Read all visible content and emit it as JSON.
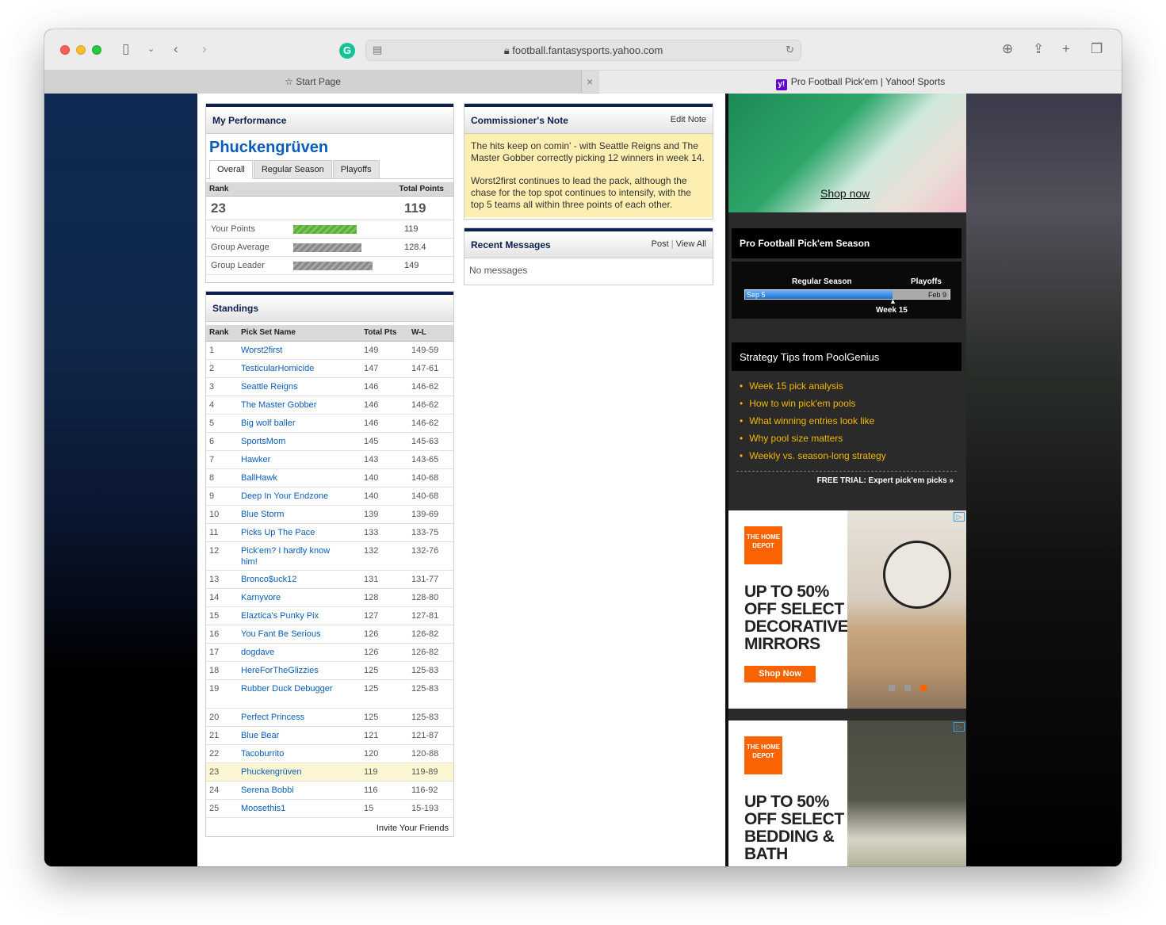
{
  "browser": {
    "url": "football.fantasysports.yahoo.com",
    "tabs": [
      {
        "label": "Start Page"
      },
      {
        "label": "Pro Football Pick'em | Yahoo! Sports"
      }
    ]
  },
  "performance": {
    "title": "My Performance",
    "team_name": "Phuckengrüven",
    "tabs": [
      "Overall",
      "Regular Season",
      "Playoffs"
    ],
    "rank_label": "Rank",
    "total_points_label": "Total Points",
    "rank": "23",
    "total_points": "119",
    "rows": [
      {
        "label": "Your Points",
        "value": "119",
        "fraction": 0.8,
        "style": "green"
      },
      {
        "label": "Group Average",
        "value": "128.4",
        "fraction": 0.86,
        "style": "gray"
      },
      {
        "label": "Group Leader",
        "value": "149",
        "fraction": 1.0,
        "style": "gray"
      }
    ]
  },
  "standings": {
    "title": "Standings",
    "columns": [
      "Rank",
      "Pick Set Name",
      "Total Pts",
      "W-L"
    ],
    "rows": [
      {
        "rank": "1",
        "name": "Worst2first",
        "pts": "149",
        "wl": "149-59"
      },
      {
        "rank": "2",
        "name": "TesticularHomicide",
        "pts": "147",
        "wl": "147-61"
      },
      {
        "rank": "3",
        "name": "Seattle Reigns",
        "pts": "146",
        "wl": "146-62"
      },
      {
        "rank": "4",
        "name": "The Master Gobber",
        "pts": "146",
        "wl": "146-62"
      },
      {
        "rank": "5",
        "name": "Big wolf baller",
        "pts": "146",
        "wl": "146-62"
      },
      {
        "rank": "6",
        "name": "SportsMom",
        "pts": "145",
        "wl": "145-63"
      },
      {
        "rank": "7",
        "name": "Hawker",
        "pts": "143",
        "wl": "143-65"
      },
      {
        "rank": "8",
        "name": "BallHawk",
        "pts": "140",
        "wl": "140-68"
      },
      {
        "rank": "9",
        "name": "Deep In Your Endzone",
        "pts": "140",
        "wl": "140-68"
      },
      {
        "rank": "10",
        "name": "Blue Storm",
        "pts": "139",
        "wl": "139-69"
      },
      {
        "rank": "11",
        "name": "Picks Up The Pace",
        "pts": "133",
        "wl": "133-75"
      },
      {
        "rank": "12",
        "name": "Pick'em? I hardly know him!",
        "pts": "132",
        "wl": "132-76",
        "wrap": true
      },
      {
        "rank": "13",
        "name": "Bronco$uck12",
        "pts": "131",
        "wl": "131-77"
      },
      {
        "rank": "14",
        "name": "Karnyvore",
        "pts": "128",
        "wl": "128-80"
      },
      {
        "rank": "15",
        "name": "Elaztica's Punky Pix",
        "pts": "127",
        "wl": "127-81"
      },
      {
        "rank": "16",
        "name": "You Fant Be Serious",
        "pts": "126",
        "wl": "126-82"
      },
      {
        "rank": "17",
        "name": "dogdave",
        "pts": "126",
        "wl": "126-82"
      },
      {
        "rank": "18",
        "name": "HereForTheGlizzies",
        "pts": "125",
        "wl": "125-83"
      },
      {
        "rank": "19",
        "name": "Rubber Duck Debugger",
        "pts": "125",
        "wl": "125-83",
        "wrap": true
      },
      {
        "rank": "20",
        "name": "Perfect Princess",
        "pts": "125",
        "wl": "125-83"
      },
      {
        "rank": "21",
        "name": "Blue Bear",
        "pts": "121",
        "wl": "121-87"
      },
      {
        "rank": "22",
        "name": "Tacoburrito",
        "pts": "120",
        "wl": "120-88"
      },
      {
        "rank": "23",
        "name": "Phuckengrüven",
        "pts": "119",
        "wl": "119-89",
        "highlight": true
      },
      {
        "rank": "24",
        "name": "Serena Bobbi",
        "pts": "116",
        "wl": "116-92"
      },
      {
        "rank": "25",
        "name": "Moosethis1",
        "pts": "15",
        "wl": "15-193"
      }
    ],
    "invite_label": "Invite Your Friends"
  },
  "commissioner": {
    "title": "Commissioner's Note",
    "edit_label": "Edit Note",
    "paragraphs": [
      "The hits keep on comin' - with Seattle Reigns and The Master Gobber correctly picking 12 winners in week 14.",
      "Worst2first continues to lead the pack, although the chase for the top spot continues to intensify, with the top 5 teams all within three points of each other."
    ]
  },
  "messages": {
    "title": "Recent Messages",
    "post_label": "Post",
    "view_all_label": "View All",
    "empty_text": "No messages"
  },
  "ad_top": {
    "cta": "Shop now"
  },
  "season": {
    "title": "Pro Football Pick'em Season",
    "regular_label": "Regular Season",
    "playoffs_label": "Playoffs",
    "start_label": "Sep 5",
    "end_label": "Feb 9",
    "current_label": "Week 15",
    "progress_fraction": 0.72
  },
  "tips": {
    "title": "Strategy Tips from PoolGenius",
    "items": [
      "Week 15 pick analysis",
      "How to win pick'em pools",
      "What winning entries look like",
      "Why pool size matters",
      "Weekly vs. season-long strategy"
    ],
    "footer": "FREE TRIAL: Expert pick'em picks »"
  },
  "ads": [
    {
      "logo": "THE HOME DEPOT",
      "headline": "UP TO 50% OFF SELECT DECORATIVE MIRRORS",
      "cta": "Shop Now"
    },
    {
      "logo": "THE HOME DEPOT",
      "headline": "UP TO 50% OFF SELECT BEDDING & BATH"
    }
  ],
  "colors": {
    "brand_navy": "#0c1f4e",
    "link_blue": "#0b5db8",
    "tip_yellow": "#f5b800",
    "home_depot_orange": "#f96302"
  }
}
